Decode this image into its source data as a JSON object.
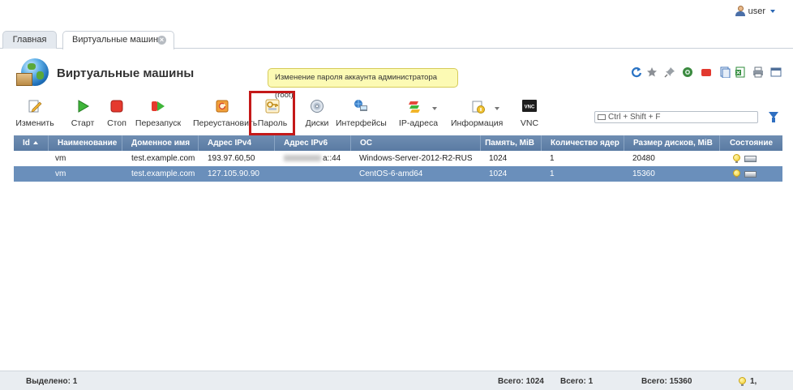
{
  "user": {
    "name": "user"
  },
  "tabs": [
    {
      "label": "Главная"
    },
    {
      "label": "Виртуальные машины"
    }
  ],
  "page": {
    "title": "Виртуальные машины"
  },
  "tooltip": {
    "text": "Изменение пароля аккаунта администратора (root)"
  },
  "right_icons": [
    "refresh-icon",
    "star-icon",
    "pin-icon",
    "globe-help-icon",
    "stop-square-icon",
    "copy-icon",
    "excel-export-icon",
    "print-icon",
    "window-icon"
  ],
  "toolbar": {
    "edit": "Изменить",
    "start": "Старт",
    "stop": "Стоп",
    "restart": "Перезапуск",
    "reinstall": "Переустановить",
    "password": "Пароль",
    "disks": "Диски",
    "interfaces": "Интерфейсы",
    "ip": "IP-адреса",
    "info": "Информация",
    "vnc": "VNC"
  },
  "search": {
    "placeholder": "Ctrl + Shift + F"
  },
  "table": {
    "headers": {
      "id": "Id",
      "name": "Наименование",
      "domain": "Доменное имя",
      "ipv4": "Адрес IPv4",
      "ipv6": "Адрес IPv6",
      "os": "ОС",
      "mem": "Память, MiB",
      "cpu": "Количество ядер",
      "disk": "Размер дисков, MiB",
      "state": "Состояние"
    },
    "rows": [
      {
        "name": "vm",
        "domain": "test.example.com",
        "ipv4": "193.97.60,50",
        "ipv6": "a::44",
        "os": "Windows-Server-2012-R2-RUS",
        "mem": "1024",
        "cpu": "1",
        "disk": "20480",
        "selected": false
      },
      {
        "name": "vm",
        "domain": "test.example.com",
        "ipv4": "127.105.90.90",
        "ipv6": "",
        "os": "CentOS-6-amd64",
        "mem": "1024",
        "cpu": "1",
        "disk": "15360",
        "selected": true
      }
    ]
  },
  "footer": {
    "selected": "Выделено: 1",
    "total_mem": "Всего: 1024",
    "total_cpu": "Всего: 1",
    "total_disk": "Всего: 15360",
    "state": "1,"
  },
  "colors": {
    "header": "#5a7ba3",
    "selected_row": "#6a8fbb",
    "highlight": "#c41919",
    "tooltip": "#fcfab4"
  }
}
